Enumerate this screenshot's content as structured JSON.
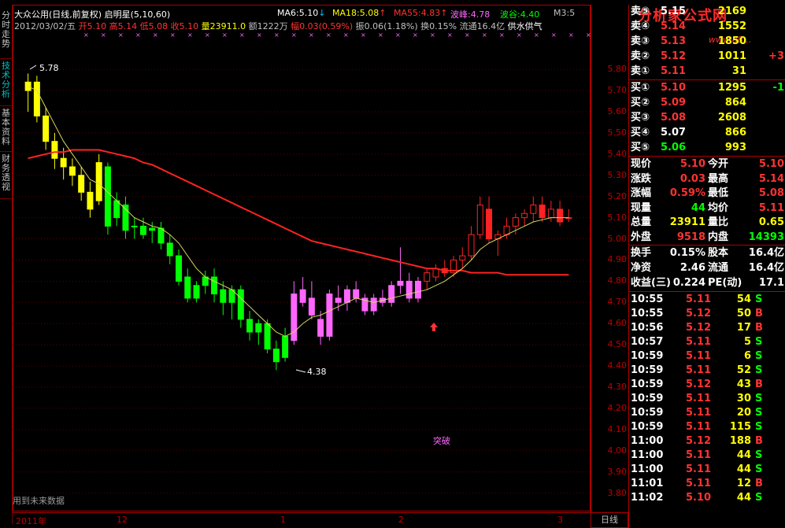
{
  "stock": {
    "name": "大众公用",
    "period_label": "(日线,前复权)",
    "indicator": "启明星",
    "params": "(5,10,60)",
    "date": "2012/03/02/五",
    "open_label": "开",
    "open": "5.10",
    "high_label": "高",
    "high": "5.14",
    "low_label": "低",
    "low": "5.08",
    "close_label": "收",
    "close": "5.10",
    "vol_label": "量",
    "vol": "23911.0",
    "amt_label": "额",
    "amt": "1222万",
    "chg_label": "幅",
    "chg": "0.03(0.59%)",
    "amp_label": "振",
    "amp": "0.06(1.18%)",
    "turn_label": "换",
    "turn": "0.15%",
    "float_label": "流通",
    "float": "16.4亿",
    "extra": "供水供气"
  },
  "ma_legend": [
    {
      "name": "MA6:",
      "value": "5.10",
      "arrow": "↓",
      "color": "#ffffff",
      "arrow_color": "#00c0ff"
    },
    {
      "name": "MA18:",
      "value": "5.08",
      "arrow": "↑",
      "color": "#ffff00",
      "arrow_color": "#ff3333"
    },
    {
      "name": "MA55:",
      "value": "4.83",
      "arrow": "↑",
      "color": "#ff3333",
      "arrow_color": "#ff3333"
    },
    {
      "name": "波峰:",
      "value": "4.78",
      "arrow": "",
      "color": "#ff66ff",
      "arrow_color": ""
    },
    {
      "name": "波谷:",
      "value": "4.40",
      "arrow": "",
      "color": "#00ff00",
      "arrow_color": ""
    },
    {
      "name": "M3:",
      "value": "5",
      "arrow": "",
      "color": "#c0c0c0",
      "arrow_color": ""
    }
  ],
  "watermark": "分析家公式网",
  "watermark_url": "www.88...",
  "side_tabs": [
    "分时走势",
    "技术分析",
    "基本资料",
    "财务透视"
  ],
  "active_tab": 1,
  "price_ticks": [
    "5.80",
    "5.70",
    "5.60",
    "5.50",
    "5.40",
    "5.30",
    "5.20",
    "5.10",
    "5.00",
    "4.90",
    "4.80",
    "4.70",
    "4.60",
    "4.50",
    "4.40",
    "4.30",
    "4.20",
    "4.10",
    "4.00",
    "3.90",
    "3.80"
  ],
  "date_labels": [
    "2011年",
    "12",
    "1",
    "2",
    "3"
  ],
  "day_line_label": "日线",
  "annotations": {
    "high_label": "5.78",
    "low_label": "4.38",
    "breakout": "突破",
    "future_note": "用到未来数据"
  },
  "chart_data": {
    "type": "candlestick",
    "ylim": [
      3.78,
      5.86
    ],
    "candles": [
      {
        "o": 5.7,
        "h": 5.78,
        "l": 5.6,
        "c": 5.74,
        "col": "#ffff00"
      },
      {
        "o": 5.74,
        "h": 5.77,
        "l": 5.55,
        "c": 5.58,
        "col": "#ffff00"
      },
      {
        "o": 5.58,
        "h": 5.62,
        "l": 5.42,
        "c": 5.46,
        "col": "#ffff00"
      },
      {
        "o": 5.46,
        "h": 5.5,
        "l": 5.33,
        "c": 5.38,
        "col": "#ffff00"
      },
      {
        "o": 5.38,
        "h": 5.43,
        "l": 5.28,
        "c": 5.34,
        "col": "#ffff00"
      },
      {
        "o": 5.34,
        "h": 5.38,
        "l": 5.25,
        "c": 5.3,
        "col": "#ffff00"
      },
      {
        "o": 5.3,
        "h": 5.34,
        "l": 5.18,
        "c": 5.22,
        "col": "#ffff00"
      },
      {
        "o": 5.22,
        "h": 5.27,
        "l": 5.1,
        "c": 5.14,
        "col": "#ffff00"
      },
      {
        "o": 5.18,
        "h": 5.4,
        "l": 5.16,
        "c": 5.36,
        "col": "#ffff00"
      },
      {
        "o": 5.34,
        "h": 5.36,
        "l": 5.02,
        "c": 5.06,
        "col": "#00ff00"
      },
      {
        "o": 5.1,
        "h": 5.22,
        "l": 5.06,
        "c": 5.18,
        "col": "#00ff00"
      },
      {
        "o": 5.16,
        "h": 5.2,
        "l": 5.0,
        "c": 5.04,
        "col": "#00ff00"
      },
      {
        "o": 5.06,
        "h": 5.1,
        "l": 5.0,
        "c": 5.06,
        "col": "#00ff00"
      },
      {
        "o": 5.06,
        "h": 5.1,
        "l": 5.0,
        "c": 5.02,
        "col": "#00ff00"
      },
      {
        "o": 5.04,
        "h": 5.08,
        "l": 4.98,
        "c": 5.05,
        "col": "#00ff00"
      },
      {
        "o": 5.05,
        "h": 5.08,
        "l": 4.95,
        "c": 4.98,
        "col": "#00ff00"
      },
      {
        "o": 4.98,
        "h": 5.02,
        "l": 4.88,
        "c": 4.92,
        "col": "#00ff00"
      },
      {
        "o": 4.92,
        "h": 4.95,
        "l": 4.78,
        "c": 4.8,
        "col": "#00ff00"
      },
      {
        "o": 4.82,
        "h": 4.86,
        "l": 4.7,
        "c": 4.72,
        "col": "#00ff00"
      },
      {
        "o": 4.72,
        "h": 4.8,
        "l": 4.7,
        "c": 4.78,
        "col": "#00ff00"
      },
      {
        "o": 4.78,
        "h": 4.85,
        "l": 4.74,
        "c": 4.82,
        "col": "#00ff00"
      },
      {
        "o": 4.82,
        "h": 4.86,
        "l": 4.7,
        "c": 4.74,
        "col": "#00ff00"
      },
      {
        "o": 4.76,
        "h": 4.8,
        "l": 4.64,
        "c": 4.7,
        "col": "#00ff00"
      },
      {
        "o": 4.7,
        "h": 4.78,
        "l": 4.62,
        "c": 4.76,
        "col": "#00ff00"
      },
      {
        "o": 4.76,
        "h": 4.78,
        "l": 4.58,
        "c": 4.62,
        "col": "#00ff00"
      },
      {
        "o": 4.62,
        "h": 4.66,
        "l": 4.52,
        "c": 4.56,
        "col": "#00ff00"
      },
      {
        "o": 4.56,
        "h": 4.62,
        "l": 4.5,
        "c": 4.6,
        "col": "#00ff00"
      },
      {
        "o": 4.6,
        "h": 4.62,
        "l": 4.46,
        "c": 4.48,
        "col": "#00ff00"
      },
      {
        "o": 4.48,
        "h": 4.52,
        "l": 4.38,
        "c": 4.42,
        "col": "#00ff00"
      },
      {
        "o": 4.44,
        "h": 4.58,
        "l": 4.42,
        "c": 4.54,
        "col": "#00ff00"
      },
      {
        "o": 4.52,
        "h": 4.8,
        "l": 4.5,
        "c": 4.74,
        "col": "#ff66ff"
      },
      {
        "o": 4.76,
        "h": 4.82,
        "l": 4.68,
        "c": 4.7,
        "col": "#ff66ff"
      },
      {
        "o": 4.72,
        "h": 4.8,
        "l": 4.62,
        "c": 4.64,
        "col": "#ff66ff"
      },
      {
        "o": 4.62,
        "h": 4.66,
        "l": 4.5,
        "c": 4.54,
        "col": "#ff66ff"
      },
      {
        "o": 4.54,
        "h": 4.76,
        "l": 4.52,
        "c": 4.74,
        "col": "#ff66ff"
      },
      {
        "o": 4.72,
        "h": 4.78,
        "l": 4.66,
        "c": 4.7,
        "col": "#ff66ff"
      },
      {
        "o": 4.7,
        "h": 4.78,
        "l": 4.66,
        "c": 4.76,
        "col": "#ff66ff"
      },
      {
        "o": 4.76,
        "h": 4.8,
        "l": 4.7,
        "c": 4.72,
        "col": "#ff66ff"
      },
      {
        "o": 4.72,
        "h": 4.74,
        "l": 4.64,
        "c": 4.66,
        "col": "#ff66ff"
      },
      {
        "o": 4.66,
        "h": 4.74,
        "l": 4.64,
        "c": 4.72,
        "col": "#ff66ff"
      },
      {
        "o": 4.72,
        "h": 4.76,
        "l": 4.68,
        "c": 4.7,
        "col": "#ff66ff"
      },
      {
        "o": 4.7,
        "h": 4.8,
        "l": 4.68,
        "c": 4.78,
        "col": "#ff66ff"
      },
      {
        "o": 4.78,
        "h": 4.96,
        "l": 4.74,
        "c": 4.8,
        "col": "#ff66ff"
      },
      {
        "o": 4.8,
        "h": 4.84,
        "l": 4.7,
        "c": 4.72,
        "col": "#ff66ff"
      },
      {
        "o": 4.72,
        "h": 4.82,
        "l": 4.7,
        "c": 4.8,
        "col": "#ff66ff"
      },
      {
        "o": 4.8,
        "h": 4.86,
        "l": 4.76,
        "c": 4.84,
        "col": "#ff2222"
      },
      {
        "o": 4.82,
        "h": 4.88,
        "l": 4.8,
        "c": 4.86,
        "col": "#ff2222"
      },
      {
        "o": 4.86,
        "h": 4.9,
        "l": 4.82,
        "c": 4.84,
        "col": "#ff2222"
      },
      {
        "o": 4.84,
        "h": 4.92,
        "l": 4.82,
        "c": 4.9,
        "col": "#ff2222"
      },
      {
        "o": 4.9,
        "h": 4.96,
        "l": 4.86,
        "c": 4.92,
        "col": "#ff2222"
      },
      {
        "o": 4.92,
        "h": 5.06,
        "l": 4.9,
        "c": 5.02,
        "col": "#ff2222"
      },
      {
        "o": 5.02,
        "h": 5.2,
        "l": 5.0,
        "c": 5.16,
        "col": "#ff2222"
      },
      {
        "o": 5.14,
        "h": 5.2,
        "l": 4.98,
        "c": 5.0,
        "col": "#ff2222"
      },
      {
        "o": 5.0,
        "h": 5.04,
        "l": 4.92,
        "c": 5.02,
        "col": "#ff2222"
      },
      {
        "o": 5.02,
        "h": 5.1,
        "l": 5.0,
        "c": 5.06,
        "col": "#ff2222"
      },
      {
        "o": 5.06,
        "h": 5.12,
        "l": 5.02,
        "c": 5.1,
        "col": "#ff2222"
      },
      {
        "o": 5.1,
        "h": 5.14,
        "l": 5.06,
        "c": 5.12,
        "col": "#ff2222"
      },
      {
        "o": 5.12,
        "h": 5.2,
        "l": 5.08,
        "c": 5.16,
        "col": "#ff2222"
      },
      {
        "o": 5.16,
        "h": 5.2,
        "l": 5.08,
        "c": 5.1,
        "col": "#ff2222"
      },
      {
        "o": 5.1,
        "h": 5.18,
        "l": 5.08,
        "c": 5.14,
        "col": "#ff2222"
      },
      {
        "o": 5.14,
        "h": 5.18,
        "l": 5.06,
        "c": 5.08,
        "col": "#ff2222"
      },
      {
        "o": 5.1,
        "h": 5.14,
        "l": 5.08,
        "c": 5.1,
        "col": "#ff2222"
      }
    ],
    "ma_fast": [
      5.72,
      5.7,
      5.62,
      5.54,
      5.46,
      5.4,
      5.34,
      5.28,
      5.26,
      5.22,
      5.18,
      5.14,
      5.1,
      5.08,
      5.06,
      5.05,
      5.02,
      4.98,
      4.92,
      4.86,
      4.82,
      4.8,
      4.78,
      4.76,
      4.72,
      4.68,
      4.64,
      4.6,
      4.56,
      4.54,
      4.56,
      4.6,
      4.63,
      4.64,
      4.66,
      4.68,
      4.7,
      4.72,
      4.71,
      4.7,
      4.71,
      4.72,
      4.73,
      4.74,
      4.75,
      4.76,
      4.78,
      4.8,
      4.83,
      4.86,
      4.9,
      4.95,
      4.98,
      5.0,
      5.02,
      5.04,
      5.06,
      5.08,
      5.09,
      5.1,
      5.1,
      5.1
    ],
    "ma_slow": [
      5.38,
      5.39,
      5.4,
      5.41,
      5.41,
      5.42,
      5.42,
      5.42,
      5.42,
      5.41,
      5.4,
      5.39,
      5.38,
      5.36,
      5.35,
      5.33,
      5.31,
      5.29,
      5.27,
      5.25,
      5.23,
      5.21,
      5.19,
      5.17,
      5.15,
      5.13,
      5.11,
      5.09,
      5.07,
      5.05,
      5.03,
      5.01,
      4.99,
      4.98,
      4.97,
      4.96,
      4.95,
      4.94,
      4.93,
      4.92,
      4.91,
      4.9,
      4.89,
      4.88,
      4.87,
      4.86,
      4.86,
      4.85,
      4.85,
      4.85,
      4.84,
      4.84,
      4.84,
      4.84,
      4.83,
      4.83,
      4.83,
      4.83,
      4.83,
      4.83,
      4.83,
      4.83
    ]
  },
  "quote": {
    "sell": [
      {
        "label": "卖⑤",
        "price": "5.15",
        "vol": "2169",
        "chg": ""
      },
      {
        "label": "卖④",
        "price": "5.14",
        "vol": "1552",
        "chg": ""
      },
      {
        "label": "卖③",
        "price": "5.13",
        "vol": "1850",
        "chg": ""
      },
      {
        "label": "卖②",
        "price": "5.12",
        "vol": "1011",
        "chg": "+3"
      },
      {
        "label": "卖①",
        "price": "5.11",
        "vol": "31",
        "chg": ""
      }
    ],
    "buy": [
      {
        "label": "买①",
        "price": "5.10",
        "vol": "1295",
        "chg": "-1"
      },
      {
        "label": "买②",
        "price": "5.09",
        "vol": "864",
        "chg": ""
      },
      {
        "label": "买③",
        "price": "5.08",
        "vol": "2608",
        "chg": ""
      },
      {
        "label": "买④",
        "price": "5.07",
        "vol": "866",
        "chg": ""
      },
      {
        "label": "买⑤",
        "price": "5.06",
        "vol": "993",
        "chg": ""
      }
    ],
    "stats": [
      {
        "l1": "现价",
        "v1": "5.10",
        "c1": "#ff3333",
        "l2": "今开",
        "v2": "5.10",
        "c2": "#ff3333"
      },
      {
        "l1": "涨跌",
        "v1": "0.03",
        "c1": "#ff3333",
        "l2": "最高",
        "v2": "5.14",
        "c2": "#ff3333"
      },
      {
        "l1": "涨幅",
        "v1": "0.59%",
        "c1": "#ff3333",
        "l2": "最低",
        "v2": "5.08",
        "c2": "#ff3333"
      },
      {
        "l1": "现量",
        "v1": "44",
        "c1": "#00ff00",
        "l2": "均价",
        "v2": "5.11",
        "c2": "#ff3333"
      },
      {
        "l1": "总量",
        "v1": "23911",
        "c1": "#ffff00",
        "l2": "量比",
        "v2": "0.65",
        "c2": "#ffff00"
      },
      {
        "l1": "外盘",
        "v1": "9518",
        "c1": "#ff3333",
        "l2": "内盘",
        "v2": "14393",
        "c2": "#00ff00"
      }
    ],
    "fund": [
      {
        "l1": "换手",
        "v1": "0.15%",
        "l2": "股本",
        "v2": "16.4亿"
      },
      {
        "l1": "净资",
        "v1": "2.46",
        "l2": "流通",
        "v2": "16.4亿"
      },
      {
        "l1": "收益(三)",
        "v1": "0.224",
        "l2": "PE(动)",
        "v2": "17.1"
      }
    ],
    "ticks": [
      {
        "t": "10:55",
        "p": "5.11",
        "v": "54",
        "s": "S"
      },
      {
        "t": "10:55",
        "p": "5.12",
        "v": "50",
        "s": "B"
      },
      {
        "t": "10:56",
        "p": "5.12",
        "v": "17",
        "s": "B"
      },
      {
        "t": "10:57",
        "p": "5.11",
        "v": "5",
        "s": "S"
      },
      {
        "t": "10:59",
        "p": "5.11",
        "v": "6",
        "s": "S"
      },
      {
        "t": "10:59",
        "p": "5.11",
        "v": "52",
        "s": "S"
      },
      {
        "t": "10:59",
        "p": "5.12",
        "v": "43",
        "s": "B"
      },
      {
        "t": "10:59",
        "p": "5.11",
        "v": "30",
        "s": "S"
      },
      {
        "t": "10:59",
        "p": "5.11",
        "v": "20",
        "s": "S"
      },
      {
        "t": "10:59",
        "p": "5.11",
        "v": "115",
        "s": "S"
      },
      {
        "t": "11:00",
        "p": "5.12",
        "v": "188",
        "s": "B"
      },
      {
        "t": "11:00",
        "p": "5.11",
        "v": "44",
        "s": "S"
      },
      {
        "t": "11:00",
        "p": "5.11",
        "v": "44",
        "s": "S"
      },
      {
        "t": "11:01",
        "p": "5.11",
        "v": "12",
        "s": "B"
      },
      {
        "t": "11:02",
        "p": "5.10",
        "v": "44",
        "s": "S"
      }
    ]
  }
}
